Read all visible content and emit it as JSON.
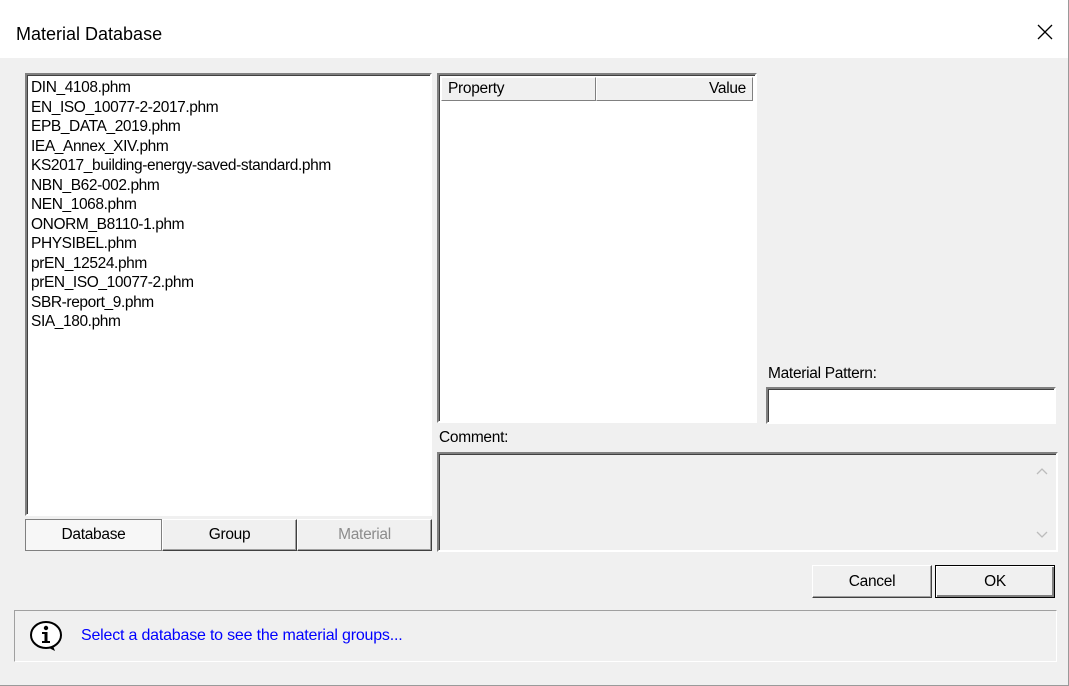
{
  "window": {
    "title": "Material Database",
    "close_icon": "close-icon"
  },
  "databases": [
    "DIN_4108.phm",
    "EN_ISO_10077-2-2017.phm",
    "EPB_DATA_2019.phm",
    "IEA_Annex_XIV.phm",
    "KS2017_building-energy-saved-standard.phm",
    "NBN_B62-002.phm",
    "NEN_1068.phm",
    "ONORM_B8110-1.phm",
    "PHYSIBEL.phm",
    "prEN_12524.phm",
    "prEN_ISO_10077-2.phm",
    "SBR-report_9.phm",
    "SIA_180.phm"
  ],
  "tabs": {
    "database": "Database",
    "group": "Group",
    "material": "Material"
  },
  "property_table": {
    "columns": {
      "property": "Property",
      "value": "Value"
    },
    "rows": []
  },
  "pattern": {
    "label": "Material Pattern:",
    "value": ""
  },
  "comment": {
    "label": "Comment:",
    "value": ""
  },
  "buttons": {
    "cancel": "Cancel",
    "ok": "OK"
  },
  "status": {
    "icon": "info-icon",
    "text": "Select a database to see the material groups..."
  },
  "colors": {
    "status_text": "#0000ff",
    "background": "#f0f0f0"
  }
}
